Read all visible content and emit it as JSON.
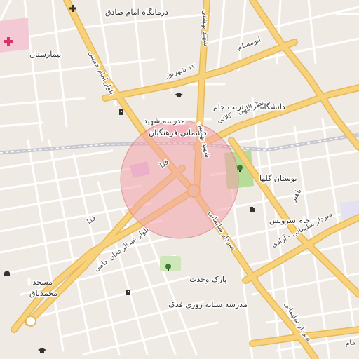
{
  "colors": {
    "background": "#efebe4",
    "minor_road": "#ffffff",
    "major_road": "#f7d27a",
    "major_road_casing": "#e6b95a",
    "railway": "#c8c8d0",
    "park": "#b7dc9a",
    "hospital_area": "#f4c9d6",
    "radius_fill": "#f2a3ab",
    "radius_stroke": "#d9534f"
  },
  "pois": [
    {
      "id": "imam-sadegh-clinic",
      "label": "درمانگاه امام صادق",
      "icon": "plus-icon"
    },
    {
      "id": "hospital",
      "label": "بیمارستان",
      "icon": "hospital-cross-icon"
    },
    {
      "id": "azad-university",
      "label": "دانشگاه آزاد تربت جام",
      "icon": "graduation-cap-icon"
    },
    {
      "id": "shahid-soleimani-school",
      "label": "مدرسه شهید سلیمانی فرهنگیان",
      "icon": "school-icon"
    },
    {
      "id": "golha-park",
      "label": "بوستان گلها",
      "icon": "tree-icon"
    },
    {
      "id": "jam-service",
      "label": "جام سرویس",
      "icon": "fuel-icon"
    },
    {
      "id": "vahdat-park",
      "label": "پارک وحدت",
      "icon": "tree-icon"
    },
    {
      "id": "fadak-school",
      "label": "مدرسه شبانه روزی فدک",
      "icon": "school-icon"
    },
    {
      "id": "mosque",
      "label": "مسجد ا‌ محمدباق",
      "icon": "mosque-icon"
    }
  ],
  "streets": [
    {
      "id": "imam-khomeini-blvd",
      "label": "بلوار امام خمینی"
    },
    {
      "id": "17-shahrivar",
      "label": "۱۷ شهریور"
    },
    {
      "id": "abu-moslem",
      "label": "ابومسلم"
    },
    {
      "id": "shahid-beheshti",
      "label": "شهید بهشتی"
    },
    {
      "id": "nasrollahi-kalani",
      "label": "نصراللهی - کلانی"
    },
    {
      "id": "fada",
      "label": "فدا"
    },
    {
      "id": "abdolrahman-jami-blvd",
      "label": "بلوار عبدالرحمان جامی"
    },
    {
      "id": "sardar-soleimani",
      "label": "سردار سلیمانی"
    },
    {
      "id": "sardar-soleimani-azadi",
      "label": "سردار سلیمانی - آزادی"
    },
    {
      "id": "bahonar",
      "label": "باهنر"
    },
    {
      "id": "sardar-soleimani-south",
      "label": "سردار سلیمانی"
    },
    {
      "id": "beheshti-north",
      "label": "شهید بهشتی"
    },
    {
      "id": "stub-south",
      "label": "مام"
    }
  ]
}
